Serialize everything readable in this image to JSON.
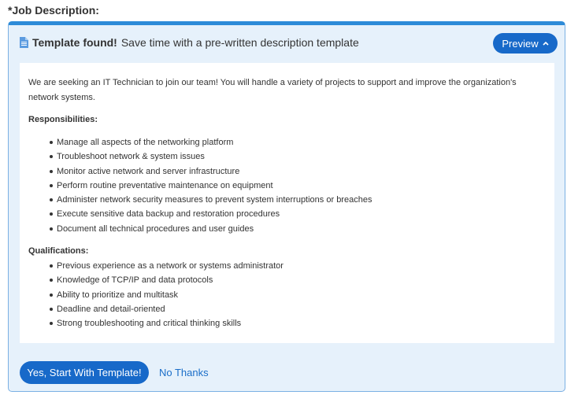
{
  "field_label": "*Job Description:",
  "header": {
    "strong": "Template found!",
    "text": "Save time with a pre-written description template",
    "icon": "document-icon"
  },
  "preview_button": {
    "label": "Preview",
    "icon": "chevron-up-icon"
  },
  "content": {
    "intro": "We are seeking an IT Technician to join our team! You will handle a variety of projects to support and improve the organization's network systems.",
    "responsibilities_title": "Responsibilities:",
    "responsibilities": [
      "Manage all aspects of the networking platform",
      "Troubleshoot network & system issues",
      "Monitor active network and server infrastructure",
      "Perform routine preventative maintenance on equipment",
      "Administer network security measures to prevent system interruptions or breaches",
      "Execute sensitive data backup and restoration procedures",
      "Document all technical procedures and user guides"
    ],
    "qualifications_title": "Qualifications:",
    "qualifications": [
      "Previous experience as a network or systems administrator",
      "Knowledge of TCP/IP and data protocols",
      "Ability to prioritize and multitask",
      "Deadline and detail-oriented",
      "Strong troubleshooting and critical thinking skills"
    ]
  },
  "actions": {
    "start_label": "Yes, Start With Template!",
    "no_thanks_label": "No Thanks"
  },
  "colors": {
    "accent": "#1769c9",
    "panel_bg": "#e6f1fb",
    "panel_border": "#2d8bd8",
    "link": "#1b6ec8"
  }
}
